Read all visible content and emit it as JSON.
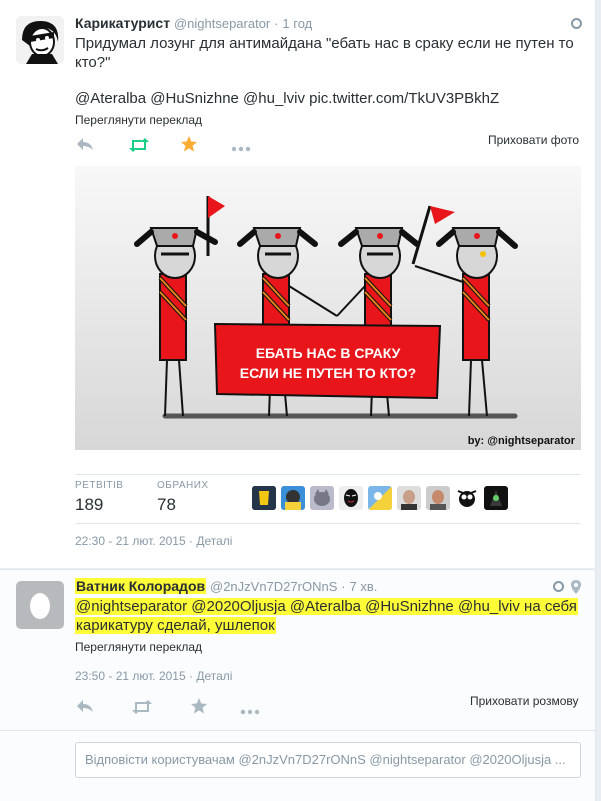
{
  "tweet1": {
    "name": "Карикатурист",
    "handle": "@nightseparator",
    "separator": "·",
    "time": "1 год",
    "text_line1": "Придумал лозунг для антимайдана \"ебать нас в сраку если не путен то",
    "text_line2": "кто?\"",
    "mentions": "@Ateralba @HuSnizhne @hu_lviv pic.twitter.com/TkUV3PBkhZ",
    "translate": "Переглянути переклад",
    "hide_photo": "Приховати фото",
    "actions": {
      "reply": "reply-icon",
      "retweet": "retweet-icon",
      "favorite": "star-icon",
      "more": "more-icon"
    },
    "photo": {
      "banner_line1": "ЕБАТЬ НАС В СРАКУ",
      "banner_line2": "ЕСЛИ НЕ ПУТЕН ТО КТО?",
      "credit": "by: @nightseparator"
    },
    "stats": {
      "retweets_label": "РЕТВІТІВ",
      "retweets": "189",
      "favorites_label": "ОБРАНИХ",
      "favorites": "78"
    },
    "timestamp": "22:30 - 21 лют. 2015",
    "details": "· Деталі"
  },
  "tweet2": {
    "name": "Ватник Колорадов",
    "handle": "@2nJzVn7D27rONnS",
    "separator": "·",
    "time": "7 хв.",
    "text_line1": "@nightseparator @2020Oljusja @Ateralba @HuSnizhne @hu_lviv на себя",
    "text_line2": "карикатуру сделай, ушлепок",
    "translate": "Переглянути переклад",
    "timestamp": "23:50 - 21 лют. 2015",
    "details": "· Деталі",
    "hide_convo": "Приховати розмову"
  },
  "reply": {
    "placeholder": "Відповісти користувачам @2nJzVn7D27rONnS @nightseparator @2020Oljusja ..."
  },
  "colors": {
    "accent_retweet": "#19cf86",
    "accent_star": "#ffac33",
    "highlight": "#fffd38",
    "banner_red": "#e8161b"
  }
}
